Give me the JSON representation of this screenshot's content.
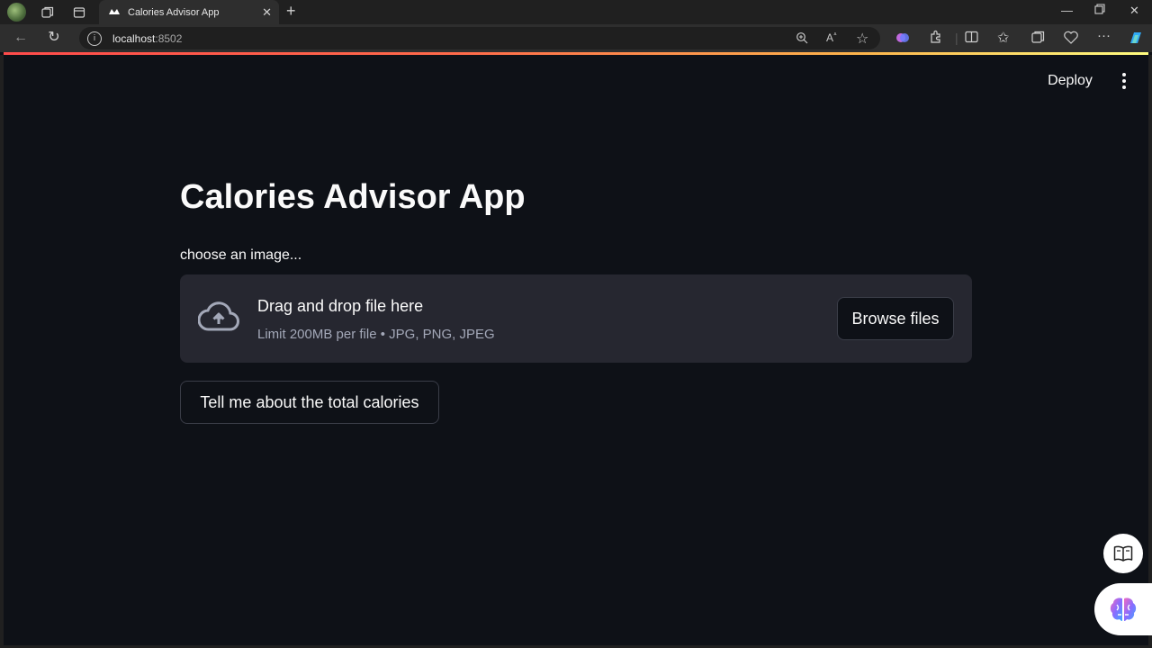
{
  "browser": {
    "tab_title": "Calories Advisor App",
    "url_host": "localhost",
    "url_port": ":8502"
  },
  "toolbar": {
    "deploy_label": "Deploy"
  },
  "main": {
    "title": "Calories Advisor App",
    "uploader_label": "choose an image...",
    "dropzone_text": "Drag and drop file here",
    "dropzone_limits": "Limit 200MB per file • JPG, PNG, JPEG",
    "browse_label": "Browse files",
    "submit_label": "Tell me about the total calories"
  },
  "colors": {
    "background": "#0e1117",
    "dropzone": "#262730",
    "accent": "#ff4b4b"
  },
  "icons": [
    "profile-avatar",
    "workspaces-icon",
    "tab-actions-icon",
    "streamlit-favicon",
    "close-icon",
    "new-tab-icon",
    "minimize-icon",
    "maximize-icon",
    "window-close-icon",
    "back-icon",
    "refresh-icon",
    "site-info-icon",
    "zoom-icon",
    "read-aloud-icon",
    "favorite-star-icon",
    "cloud-upload-icon",
    "reader-book-icon",
    "copilot-brain-icon"
  ]
}
